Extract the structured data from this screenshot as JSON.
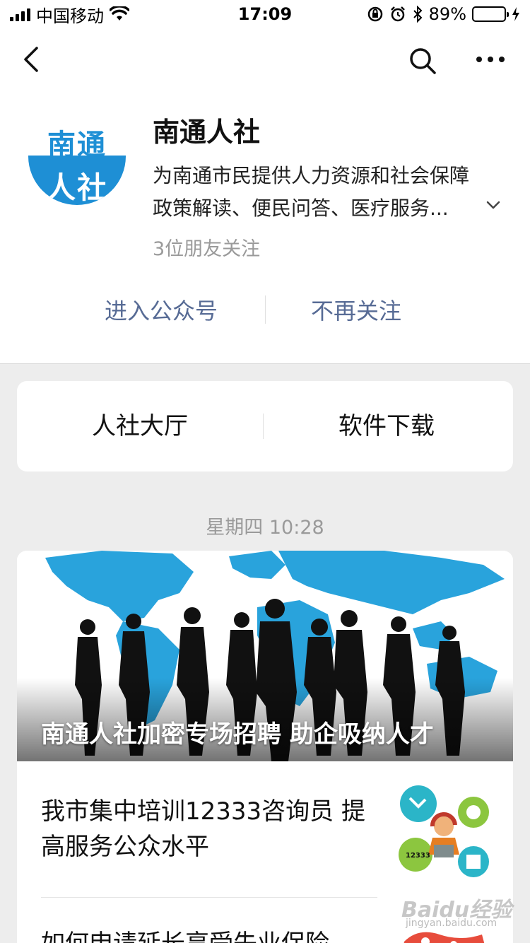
{
  "status_bar": {
    "carrier": "中国移动",
    "time": "17:09",
    "battery_percent": "89%",
    "battery_level": 0.89,
    "battery_color": "#4cd964"
  },
  "nav": {
    "back_icon": "chevron-left-icon",
    "search_icon": "search-icon",
    "more_icon": "more-dots-icon"
  },
  "account": {
    "logo_text_top": "南通",
    "logo_text_bottom": "人社",
    "logo_color": "#1e8fd5",
    "name": "南通人社",
    "description_line1": "为南通市民提供人力资源和社会保障",
    "description_line2": "政策解读、便民问答、医疗服务...",
    "friends_following": "3位朋友关注",
    "link_color": "#576b95"
  },
  "actions": {
    "enter": "进入公众号",
    "unfollow": "不再关注"
  },
  "menu": {
    "items": [
      {
        "label": "人社大厅"
      },
      {
        "label": "软件下载"
      }
    ]
  },
  "feed": {
    "timestamp": "星期四 10:28",
    "cover_title": "南通人社加密专场招聘 助企吸纳人才",
    "articles": [
      {
        "title": "我市集中培训12333咨询员 提高服务公众水平",
        "thumb_text": "12333"
      },
      {
        "title": "如何申请延长享受失业保险"
      }
    ]
  },
  "watermark": {
    "text": "Baidu经验",
    "sub": "jingyan.baidu.com"
  }
}
